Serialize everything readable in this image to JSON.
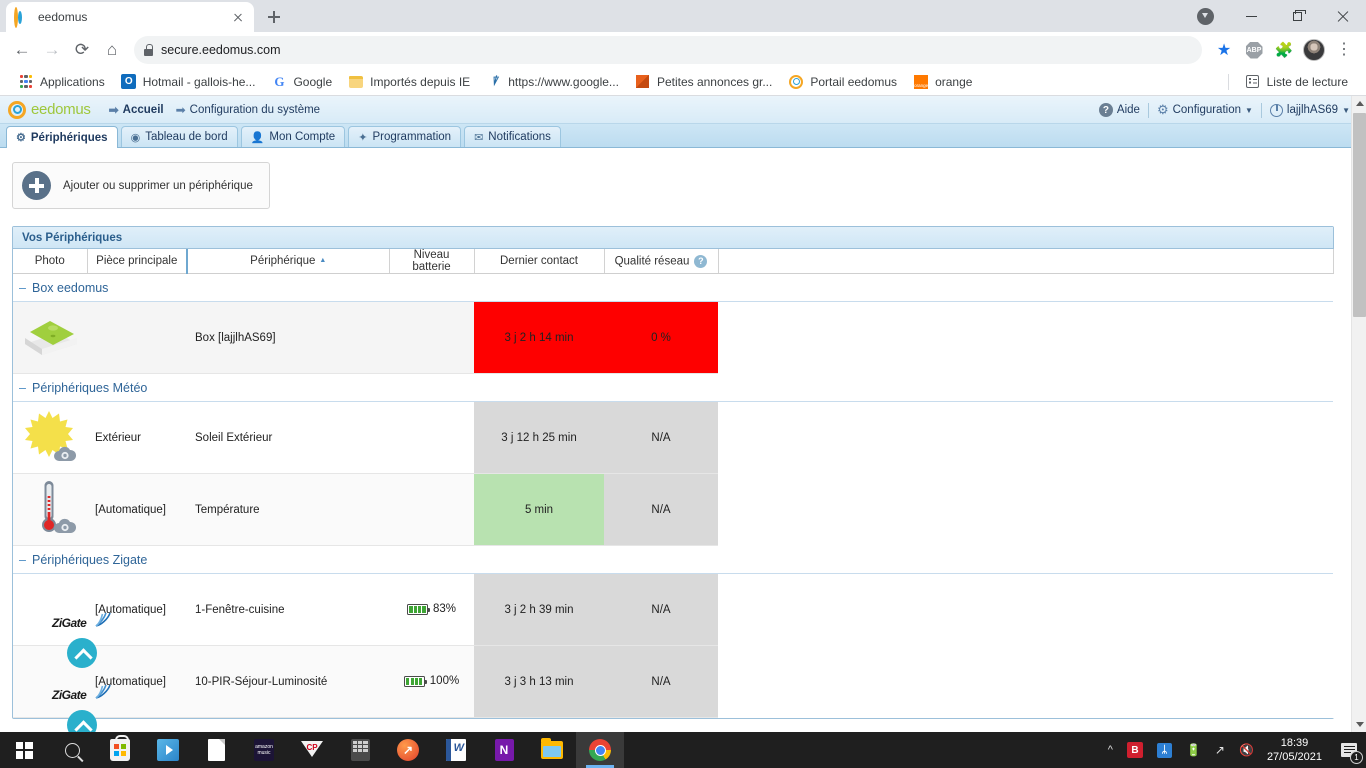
{
  "browser": {
    "tab": {
      "title": "eedomus",
      "favicon": "eedomus-ring-icon"
    },
    "url": "secure.eedomus.com",
    "nav": {
      "back": "←",
      "forward": "→",
      "reload": "⟳",
      "home": "⌂"
    },
    "bookmarks": [
      {
        "label": "Applications",
        "icon": "apps-grid-icon"
      },
      {
        "label": "Hotmail - gallois-he...",
        "icon": "outlook-icon"
      },
      {
        "label": "Google",
        "icon": "google-g-icon"
      },
      {
        "label": "Importés depuis IE",
        "icon": "folder-icon"
      },
      {
        "label": "https://www.google...",
        "icon": "ie-icon"
      },
      {
        "label": "Petites annonces gr...",
        "icon": "orange-square-icon"
      },
      {
        "label": "Portail eedomus",
        "icon": "eedomus-ring-icon"
      },
      {
        "label": "orange",
        "icon": "orange-box-icon"
      }
    ],
    "reading_list": "Liste de lecture"
  },
  "eedomus": {
    "brand": "eedomus",
    "breadcrumbs": [
      {
        "label": "Accueil",
        "bold": true
      },
      {
        "label": "Configuration du système",
        "bold": false
      }
    ],
    "header_right": {
      "help": "Aide",
      "configuration": "Configuration",
      "user": "lajjlhAS69"
    },
    "tabs": [
      {
        "label": "Périphériques",
        "icon": "devices-icon",
        "active": true
      },
      {
        "label": "Tableau de bord",
        "icon": "dashboard-icon",
        "active": false
      },
      {
        "label": "Mon Compte",
        "icon": "user-icon",
        "active": false
      },
      {
        "label": "Programmation",
        "icon": "magic-wand-icon",
        "active": false
      },
      {
        "label": "Notifications",
        "icon": "envelope-icon",
        "active": false
      }
    ],
    "add_button": "Ajouter ou supprimer un périphérique",
    "panel_title": "Vos Périphériques",
    "columns": {
      "photo": "Photo",
      "piece": "Pièce principale",
      "peripherique": "Périphérique",
      "sort_indicator": "▲",
      "batterie": "Niveau batterie",
      "contact": "Dernier contact",
      "qualite": "Qualité réseau",
      "qualite_help": "?"
    },
    "groups": [
      {
        "name": "Box eedomus",
        "collapse": "–",
        "rows": [
          {
            "icon": "eedomus-box-icon",
            "piece": "",
            "peripherique": "Box [lajjlhAS69]",
            "battery": "",
            "battery_pct": null,
            "contact": "3 j 2 h 14 min",
            "contact_state": "red",
            "quality": "0 %",
            "quality_state": "red",
            "alt": false
          }
        ]
      },
      {
        "name": "Périphériques Météo",
        "collapse": "–",
        "rows": [
          {
            "icon": "sun-cloud-icon",
            "piece": "Extérieur",
            "peripherique": "Soleil Extérieur",
            "battery": "",
            "battery_pct": null,
            "contact": "3 j 12 h 25 min",
            "contact_state": "grey",
            "quality": "N/A",
            "quality_state": "grey",
            "alt": false
          },
          {
            "icon": "thermometer-cloud-icon",
            "piece": "[Automatique]",
            "peripherique": "Température",
            "battery": "",
            "battery_pct": null,
            "contact": "5 min",
            "contact_state": "green",
            "quality": "N/A",
            "quality_state": "grey",
            "alt": true
          }
        ]
      },
      {
        "name": "Périphériques Zigate",
        "collapse": "–",
        "rows": [
          {
            "icon": "zigate-icon",
            "piece": "[Automatique]",
            "peripherique": "1-Fenêtre-cuisine",
            "battery": "83%",
            "battery_pct": 83,
            "contact": "3 j 2 h 39 min",
            "contact_state": "grey",
            "quality": "N/A",
            "quality_state": "grey",
            "alt": false
          },
          {
            "icon": "zigate-icon",
            "piece": "[Automatique]",
            "peripherique": "10-PIR-Séjour-Luminosité",
            "battery": "100%",
            "battery_pct": 100,
            "contact": "3 j 3 h 13 min",
            "contact_state": "grey",
            "quality": "N/A",
            "quality_state": "grey",
            "alt": true
          }
        ]
      }
    ],
    "colors": {
      "alert_red": "#fe0000",
      "ok_green": "#b8e2b0",
      "neutral_grey": "#d9d9d9",
      "brand_green": "#9ec73c",
      "brand_blue": "#2aa3d8",
      "brand_orange": "#f5a623"
    }
  },
  "taskbar": {
    "items": [
      {
        "name": "start-button",
        "icon": "windows-logo-icon"
      },
      {
        "name": "search-button",
        "icon": "search-icon"
      },
      {
        "name": "microsoft-store",
        "icon": "store-icon"
      },
      {
        "name": "media-player",
        "icon": "media-player-icon"
      },
      {
        "name": "notepad",
        "icon": "document-icon"
      },
      {
        "name": "amazon-music",
        "icon": "amazon-music-icon"
      },
      {
        "name": "cp-app",
        "icon": "cp-icon",
        "label": "CP"
      },
      {
        "name": "calculator",
        "icon": "calculator-icon"
      },
      {
        "name": "firefox",
        "icon": "flame-icon"
      },
      {
        "name": "word",
        "icon": "word-icon",
        "label": "W"
      },
      {
        "name": "onenote",
        "icon": "onenote-icon",
        "label": "N"
      },
      {
        "name": "file-explorer",
        "icon": "folder-icon"
      },
      {
        "name": "chrome",
        "icon": "chrome-icon",
        "active": true
      }
    ],
    "tray": {
      "bitdefender": "B",
      "bluetooth": "ᛦ",
      "battery": "battery-icon",
      "wifi": "wifi-icon",
      "volume": "volume-muted-icon",
      "time": "18:39",
      "date": "27/05/2021",
      "notifications_count": "1"
    }
  }
}
